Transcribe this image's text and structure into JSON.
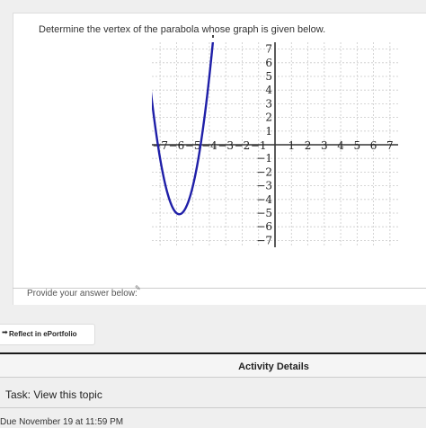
{
  "question": {
    "prompt": "Determine the vertex of the parabola whose graph is given below."
  },
  "chart_data": {
    "type": "line",
    "title": "",
    "xlabel": "",
    "ylabel": "",
    "xlim": [
      -7.5,
      7.5
    ],
    "ylim": [
      -7.5,
      7.5
    ],
    "grid": true,
    "x_tick_labels": [
      "−7",
      "−6",
      "−5",
      "−4",
      "−3",
      "−2",
      "−1",
      "1",
      "2",
      "3",
      "4",
      "5",
      "6",
      "7"
    ],
    "y_tick_labels": [
      "7",
      "6",
      "5",
      "4",
      "3",
      "2",
      "1",
      "−1",
      "−2",
      "−3",
      "−4",
      "−5",
      "−6",
      "−7"
    ],
    "curve_color": "#1f1fa8",
    "series": [
      {
        "x": [
          -8,
          -7.5,
          -7,
          -6.5,
          -6,
          -5.5,
          -5,
          -4.5,
          -4,
          -3.5,
          -3,
          -2.5,
          -2
        ],
        "y": [
          9,
          3.25,
          -1,
          -3.75,
          -5,
          -4.75,
          -3,
          0.25,
          5,
          11.25,
          19,
          28.25,
          39
        ]
      }
    ]
  },
  "answer": {
    "label": "Provide your answer below:"
  },
  "reflect": {
    "label": "Reflect in ePortfolio"
  },
  "activity": {
    "title": "Activity Details",
    "task": "Task: View this topic",
    "due": "Due November 19 at 11:59 PM"
  }
}
